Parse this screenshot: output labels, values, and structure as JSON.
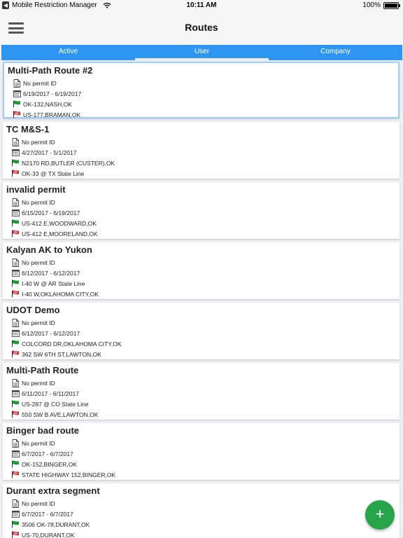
{
  "status_bar": {
    "app_back": "Mobile Restriction Manager",
    "time": "10:11 AM",
    "battery": "100%"
  },
  "nav": {
    "title": "Routes"
  },
  "tabs": [
    {
      "label": "Active"
    },
    {
      "label": "User"
    },
    {
      "label": "Company"
    }
  ],
  "active_tab": "User",
  "routes": [
    {
      "name": "Multi-Path Route #2",
      "permit": "No permit ID",
      "dates": "6/19/2017 - 6/19/2017",
      "start": "OK-132,NASH,OK",
      "end": "US-177,BRAMAN,OK"
    },
    {
      "name": "TC M&S-1",
      "permit": "No permit ID",
      "dates": "4/27/2017 - 5/1/2017",
      "start": "N2170 RD,BUTLER (CUSTER),OK",
      "end": "OK-33 @ TX State Line"
    },
    {
      "name": "invalid permit",
      "permit": "No permit ID",
      "dates": "6/15/2017 - 6/19/2017",
      "start": "US-412 E,WOODWARD,OK",
      "end": "US-412 E,MOORELAND,OK"
    },
    {
      "name": "Kalyan AK to Yukon",
      "permit": "No permit ID",
      "dates": "6/12/2017 - 6/12/2017",
      "start": "I-40 W @ AR State Line",
      "end": "I-40 W,OKLAHOMA CITY,OK"
    },
    {
      "name": "UDOT Demo",
      "permit": "No permit ID",
      "dates": "6/12/2017 - 6/12/2017",
      "start": "COLCORD DR,OKLAHOMA CITY,OK",
      "end": "362 SW 6TH ST,LAWTON,OK"
    },
    {
      "name": "Multi-Path Route",
      "permit": "No permit ID",
      "dates": "6/11/2017 - 6/11/2017",
      "start": "US-287 @ CO State Line",
      "end": "550 SW B AVE,LAWTON,OK"
    },
    {
      "name": "Binger bad route",
      "permit": "No permit ID",
      "dates": "6/7/2017 - 6/7/2017",
      "start": "OK-152,BINGER,OK",
      "end": "STATE HIGHWAY 152,BINGER,OK"
    },
    {
      "name": "Durant extra segment",
      "permit": "No permit ID",
      "dates": "6/7/2017 - 6/7/2017",
      "start": "3506 OK-78,DURANT,OK",
      "end": "US-70,DURANT,OK"
    }
  ],
  "fab": {
    "label": "+"
  },
  "colors": {
    "tab_bar": "#2f95f3",
    "fab": "#27a44a",
    "start_flag": "#1e9a35",
    "end_flag": "#d0202e",
    "selected_border": "#9fcdf6"
  },
  "icons": {
    "permit": "document-icon",
    "dates": "calendar-icon",
    "start": "green-flag-icon",
    "end": "checkered-flag-icon"
  }
}
